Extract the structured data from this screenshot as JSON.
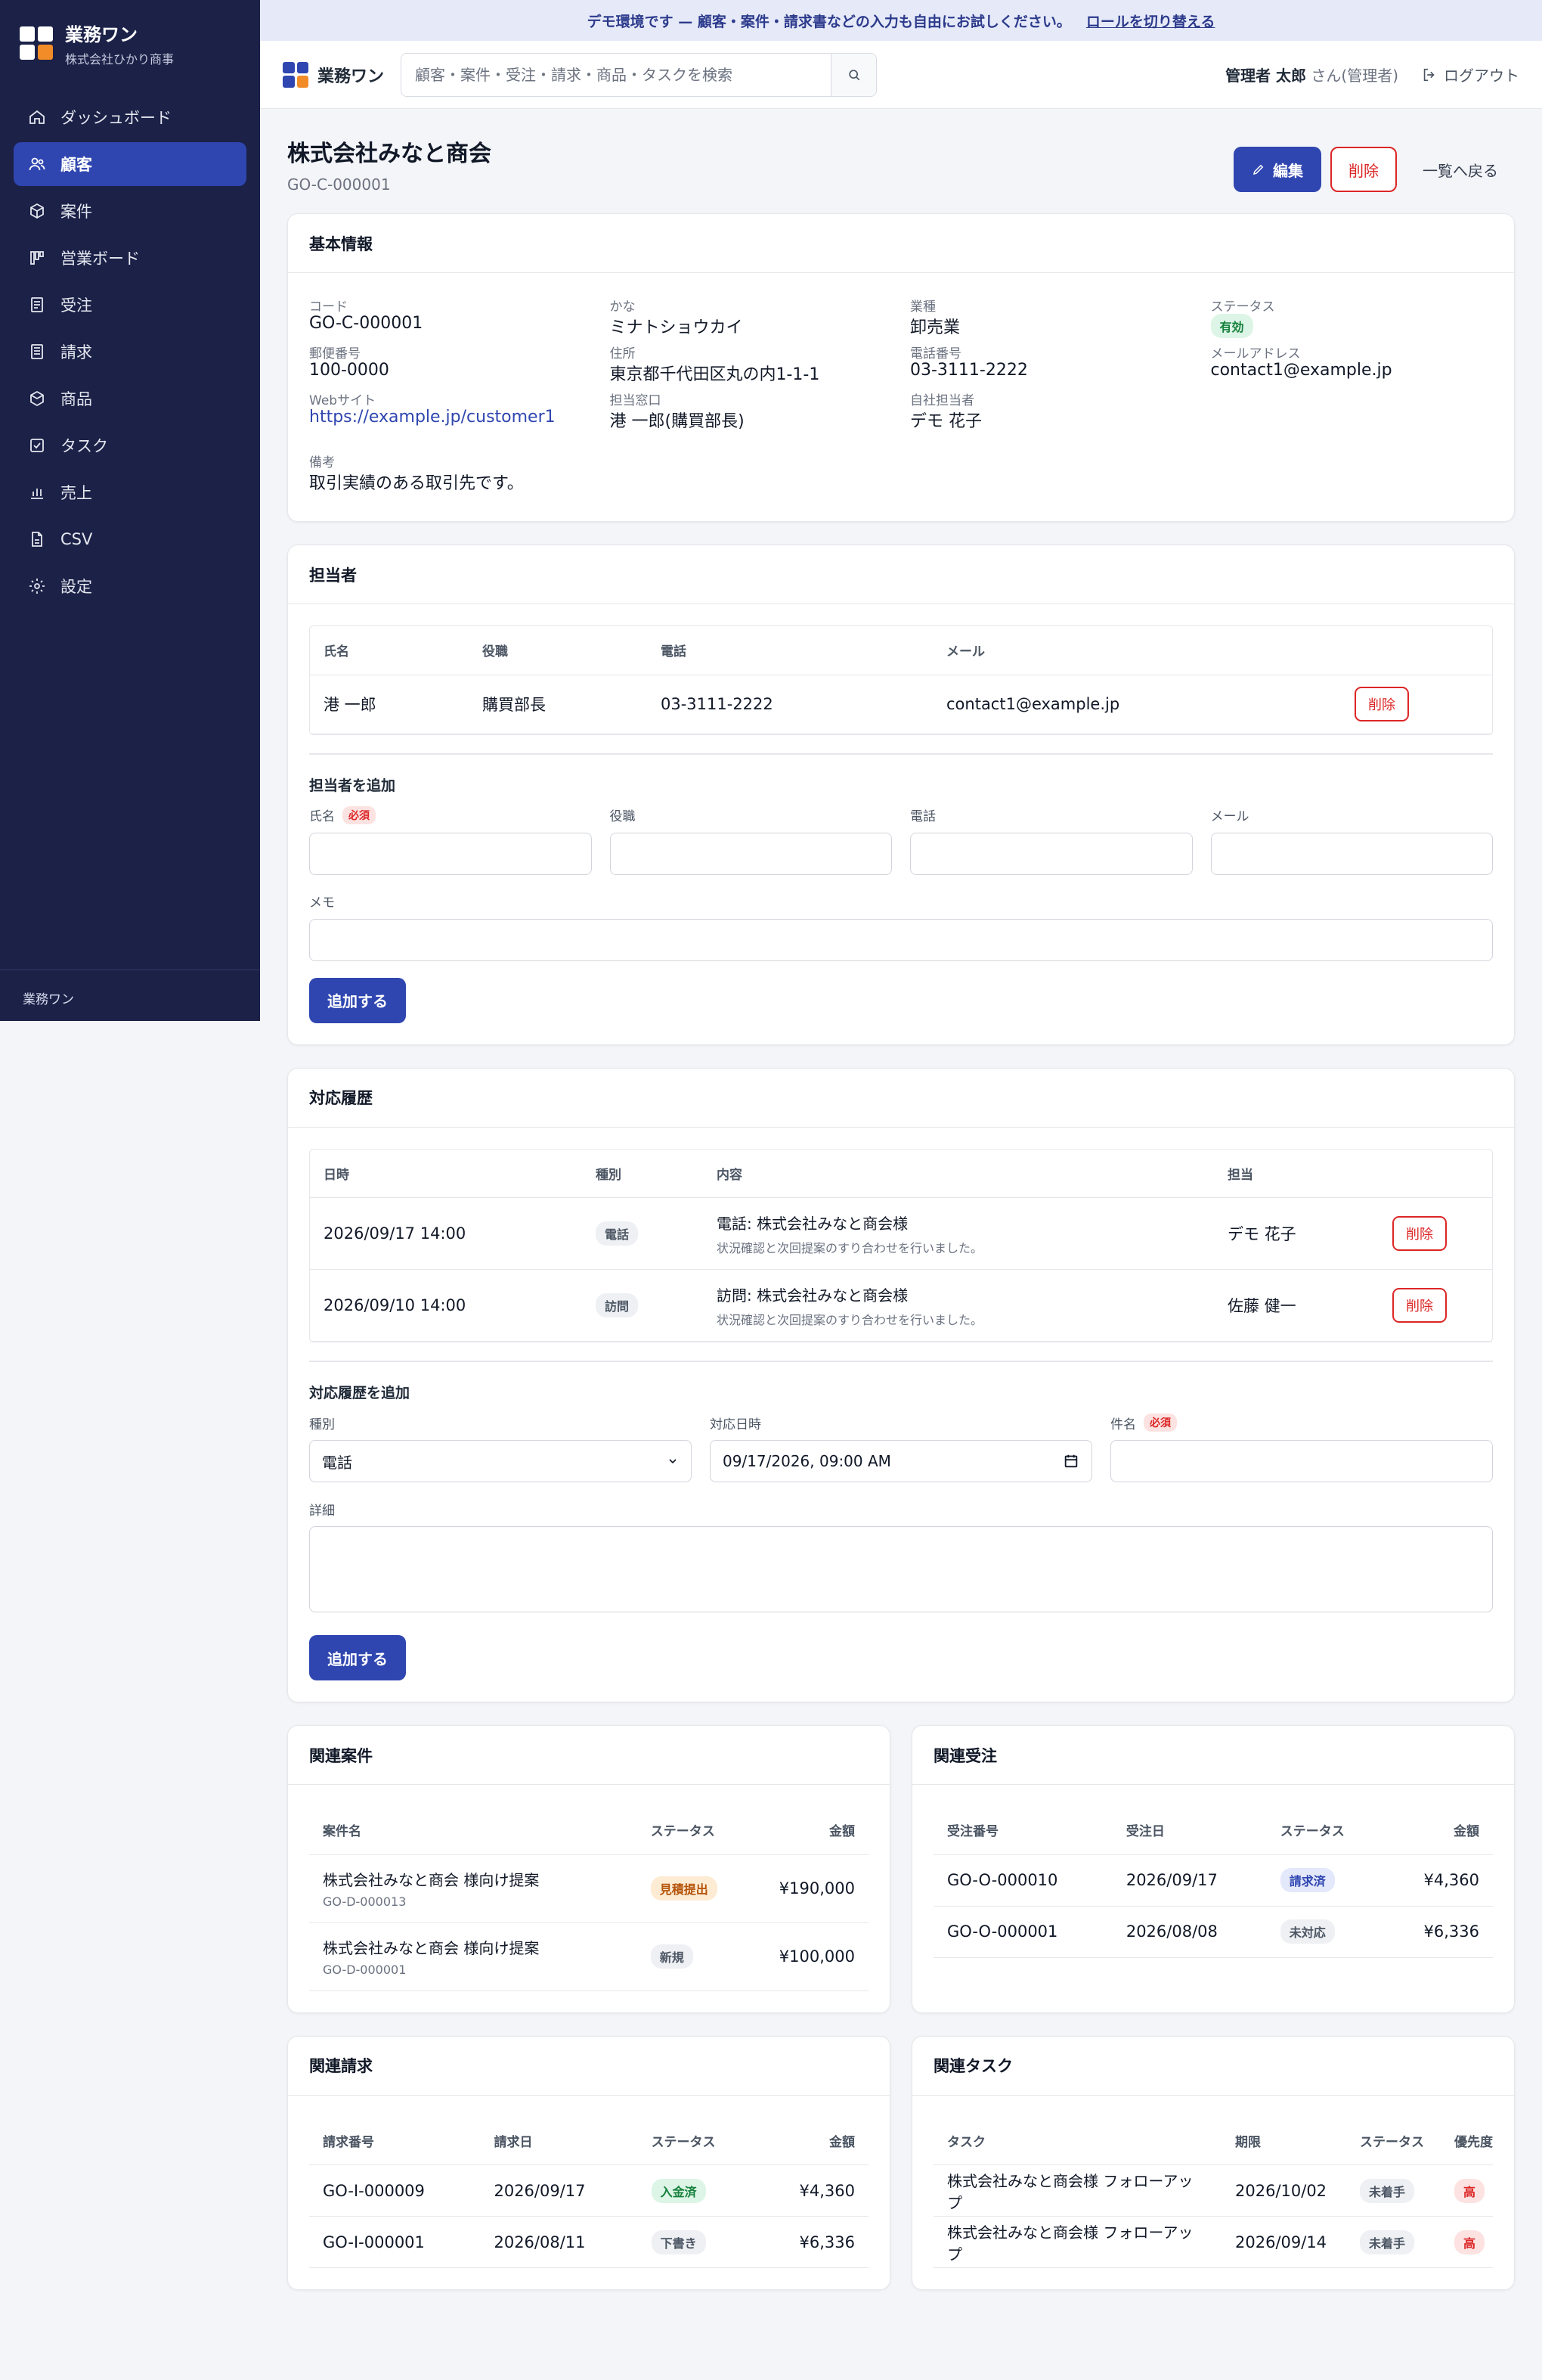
{
  "app": {
    "name": "業務ワン",
    "company": "株式会社ひかり商事",
    "footer": "業務ワン"
  },
  "nav": [
    {
      "label": "ダッシュボード",
      "icon": "home-icon"
    },
    {
      "label": "顧客",
      "icon": "users-icon",
      "active": true
    },
    {
      "label": "案件",
      "icon": "box-icon"
    },
    {
      "label": "営業ボード",
      "icon": "kanban-icon"
    },
    {
      "label": "受注",
      "icon": "document-icon"
    },
    {
      "label": "請求",
      "icon": "invoice-icon"
    },
    {
      "label": "商品",
      "icon": "package-icon"
    },
    {
      "label": "タスク",
      "icon": "checkbox-icon"
    },
    {
      "label": "売上",
      "icon": "bar-chart-icon"
    },
    {
      "label": "CSV",
      "icon": "file-icon"
    },
    {
      "label": "設定",
      "icon": "gear-icon"
    }
  ],
  "banner": {
    "text": "デモ環境です — 顧客・案件・請求書などの入力も自由にお試しください。",
    "link": "ロールを切り替える"
  },
  "topbar": {
    "search_placeholder": "顧客・案件・受注・請求・商品・タスクを検索",
    "user_name": "管理者 太郎",
    "user_suffix": "さん(管理者)",
    "logout": "ログアウト"
  },
  "page": {
    "title": "株式会社みなと商会",
    "code": "GO-C-000001",
    "edit": "編集",
    "delete": "削除",
    "back": "一覧へ戻る"
  },
  "basic": {
    "title": "基本情報",
    "code_label": "コード",
    "code": "GO-C-000001",
    "kana_label": "かな",
    "kana": "ミナトショウカイ",
    "industry_label": "業種",
    "industry": "卸売業",
    "status_label": "ステータス",
    "status": "有効",
    "zip_label": "郵便番号",
    "zip": "100-0000",
    "address_label": "住所",
    "address": "東京都千代田区丸の内1-1-1",
    "phone_label": "電話番号",
    "phone": "03-3111-2222",
    "email_label": "メールアドレス",
    "email": "contact1@example.jp",
    "web_label": "Webサイト",
    "web": "https://example.jp/customer1",
    "contact_label": "担当窓口",
    "contact": "港 一郎(購買部長)",
    "owner_label": "自社担当者",
    "owner": "デモ 花子",
    "note_label": "備考",
    "note": "取引実績のある取引先です。"
  },
  "contacts": {
    "title": "担当者",
    "headers": [
      "氏名",
      "役職",
      "電話",
      "メール"
    ],
    "rows": [
      {
        "name": "港 一郎",
        "role": "購買部長",
        "phone": "03-3111-2222",
        "email": "contact1@example.jp",
        "action": "削除"
      }
    ],
    "add_title": "担当者を追加",
    "name_label": "氏名",
    "required": "必須",
    "role_label": "役職",
    "phone_label": "電話",
    "email_label": "メール",
    "memo_label": "メモ",
    "submit": "追加する"
  },
  "history": {
    "title": "対応履歴",
    "headers": [
      "日時",
      "種別",
      "内容",
      "担当"
    ],
    "rows": [
      {
        "datetime": "2026/09/17 14:00",
        "type": "電話",
        "subject": "電話: 株式会社みなと商会様",
        "detail": "状況確認と次回提案のすり合わせを行いました。",
        "owner": "デモ 花子",
        "action": "削除"
      },
      {
        "datetime": "2026/09/10 14:00",
        "type": "訪問",
        "subject": "訪問: 株式会社みなと商会様",
        "detail": "状況確認と次回提案のすり合わせを行いました。",
        "owner": "佐藤 健一",
        "action": "削除"
      }
    ],
    "add_title": "対応履歴を追加",
    "type_label": "種別",
    "type_value": "電話",
    "date_label": "対応日時",
    "date_value": "09/17/2026, 09:00 AM",
    "subject_label": "件名",
    "required": "必須",
    "detail_label": "詳細",
    "submit": "追加する"
  },
  "deals": {
    "title": "関連案件",
    "headers": [
      "案件名",
      "ステータス",
      "金額"
    ],
    "rows": [
      {
        "name": "株式会社みなと商会 様向け提案",
        "code": "GO-D-000013",
        "status": "見積提出",
        "amount": "¥190,000"
      },
      {
        "name": "株式会社みなと商会 様向け提案",
        "code": "GO-D-000001",
        "status": "新規",
        "amount": "¥100,000"
      }
    ]
  },
  "orders": {
    "title": "関連受注",
    "headers": [
      "受注番号",
      "受注日",
      "ステータス",
      "金額"
    ],
    "rows": [
      {
        "no": "GO-O-000010",
        "date": "2026/09/17",
        "status": "請求済",
        "amount": "¥4,360"
      },
      {
        "no": "GO-O-000001",
        "date": "2026/08/08",
        "status": "未対応",
        "amount": "¥6,336"
      }
    ]
  },
  "invoices": {
    "title": "関連請求",
    "headers": [
      "請求番号",
      "請求日",
      "ステータス",
      "金額"
    ],
    "rows": [
      {
        "no": "GO-I-000009",
        "date": "2026/09/17",
        "status": "入金済",
        "amount": "¥4,360"
      },
      {
        "no": "GO-I-000001",
        "date": "2026/08/11",
        "status": "下書き",
        "amount": "¥6,336"
      }
    ]
  },
  "tasks": {
    "title": "関連タスク",
    "headers": [
      "タスク",
      "期限",
      "ステータス",
      "優先度"
    ],
    "rows": [
      {
        "name": "株式会社みなと商会様 フォローアップ",
        "due": "2026/10/02",
        "status": "未着手",
        "priority": "高"
      },
      {
        "name": "株式会社みなと商会様 フォローアップ",
        "due": "2026/09/14",
        "status": "未着手",
        "priority": "高"
      }
    ]
  },
  "colors": {
    "sidebar": "#1b2147",
    "accent": "#2f46b0",
    "danger": "#dc2626"
  }
}
